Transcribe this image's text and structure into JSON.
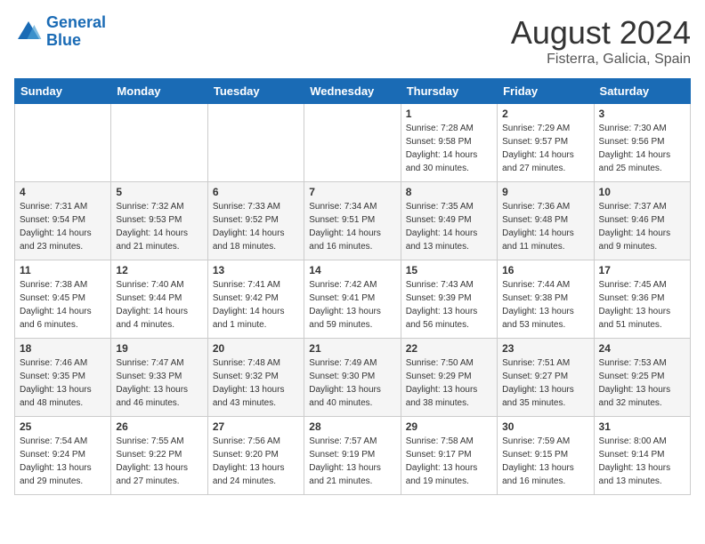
{
  "header": {
    "logo_line1": "General",
    "logo_line2": "Blue",
    "month": "August 2024",
    "location": "Fisterra, Galicia, Spain"
  },
  "days_of_week": [
    "Sunday",
    "Monday",
    "Tuesday",
    "Wednesday",
    "Thursday",
    "Friday",
    "Saturday"
  ],
  "weeks": [
    [
      {
        "day": "",
        "content": ""
      },
      {
        "day": "",
        "content": ""
      },
      {
        "day": "",
        "content": ""
      },
      {
        "day": "",
        "content": ""
      },
      {
        "day": "1",
        "content": "Sunrise: 7:28 AM\nSunset: 9:58 PM\nDaylight: 14 hours\nand 30 minutes."
      },
      {
        "day": "2",
        "content": "Sunrise: 7:29 AM\nSunset: 9:57 PM\nDaylight: 14 hours\nand 27 minutes."
      },
      {
        "day": "3",
        "content": "Sunrise: 7:30 AM\nSunset: 9:56 PM\nDaylight: 14 hours\nand 25 minutes."
      }
    ],
    [
      {
        "day": "4",
        "content": "Sunrise: 7:31 AM\nSunset: 9:54 PM\nDaylight: 14 hours\nand 23 minutes."
      },
      {
        "day": "5",
        "content": "Sunrise: 7:32 AM\nSunset: 9:53 PM\nDaylight: 14 hours\nand 21 minutes."
      },
      {
        "day": "6",
        "content": "Sunrise: 7:33 AM\nSunset: 9:52 PM\nDaylight: 14 hours\nand 18 minutes."
      },
      {
        "day": "7",
        "content": "Sunrise: 7:34 AM\nSunset: 9:51 PM\nDaylight: 14 hours\nand 16 minutes."
      },
      {
        "day": "8",
        "content": "Sunrise: 7:35 AM\nSunset: 9:49 PM\nDaylight: 14 hours\nand 13 minutes."
      },
      {
        "day": "9",
        "content": "Sunrise: 7:36 AM\nSunset: 9:48 PM\nDaylight: 14 hours\nand 11 minutes."
      },
      {
        "day": "10",
        "content": "Sunrise: 7:37 AM\nSunset: 9:46 PM\nDaylight: 14 hours\nand 9 minutes."
      }
    ],
    [
      {
        "day": "11",
        "content": "Sunrise: 7:38 AM\nSunset: 9:45 PM\nDaylight: 14 hours\nand 6 minutes."
      },
      {
        "day": "12",
        "content": "Sunrise: 7:40 AM\nSunset: 9:44 PM\nDaylight: 14 hours\nand 4 minutes."
      },
      {
        "day": "13",
        "content": "Sunrise: 7:41 AM\nSunset: 9:42 PM\nDaylight: 14 hours\nand 1 minute."
      },
      {
        "day": "14",
        "content": "Sunrise: 7:42 AM\nSunset: 9:41 PM\nDaylight: 13 hours\nand 59 minutes."
      },
      {
        "day": "15",
        "content": "Sunrise: 7:43 AM\nSunset: 9:39 PM\nDaylight: 13 hours\nand 56 minutes."
      },
      {
        "day": "16",
        "content": "Sunrise: 7:44 AM\nSunset: 9:38 PM\nDaylight: 13 hours\nand 53 minutes."
      },
      {
        "day": "17",
        "content": "Sunrise: 7:45 AM\nSunset: 9:36 PM\nDaylight: 13 hours\nand 51 minutes."
      }
    ],
    [
      {
        "day": "18",
        "content": "Sunrise: 7:46 AM\nSunset: 9:35 PM\nDaylight: 13 hours\nand 48 minutes."
      },
      {
        "day": "19",
        "content": "Sunrise: 7:47 AM\nSunset: 9:33 PM\nDaylight: 13 hours\nand 46 minutes."
      },
      {
        "day": "20",
        "content": "Sunrise: 7:48 AM\nSunset: 9:32 PM\nDaylight: 13 hours\nand 43 minutes."
      },
      {
        "day": "21",
        "content": "Sunrise: 7:49 AM\nSunset: 9:30 PM\nDaylight: 13 hours\nand 40 minutes."
      },
      {
        "day": "22",
        "content": "Sunrise: 7:50 AM\nSunset: 9:29 PM\nDaylight: 13 hours\nand 38 minutes."
      },
      {
        "day": "23",
        "content": "Sunrise: 7:51 AM\nSunset: 9:27 PM\nDaylight: 13 hours\nand 35 minutes."
      },
      {
        "day": "24",
        "content": "Sunrise: 7:53 AM\nSunset: 9:25 PM\nDaylight: 13 hours\nand 32 minutes."
      }
    ],
    [
      {
        "day": "25",
        "content": "Sunrise: 7:54 AM\nSunset: 9:24 PM\nDaylight: 13 hours\nand 29 minutes."
      },
      {
        "day": "26",
        "content": "Sunrise: 7:55 AM\nSunset: 9:22 PM\nDaylight: 13 hours\nand 27 minutes."
      },
      {
        "day": "27",
        "content": "Sunrise: 7:56 AM\nSunset: 9:20 PM\nDaylight: 13 hours\nand 24 minutes."
      },
      {
        "day": "28",
        "content": "Sunrise: 7:57 AM\nSunset: 9:19 PM\nDaylight: 13 hours\nand 21 minutes."
      },
      {
        "day": "29",
        "content": "Sunrise: 7:58 AM\nSunset: 9:17 PM\nDaylight: 13 hours\nand 19 minutes."
      },
      {
        "day": "30",
        "content": "Sunrise: 7:59 AM\nSunset: 9:15 PM\nDaylight: 13 hours\nand 16 minutes."
      },
      {
        "day": "31",
        "content": "Sunrise: 8:00 AM\nSunset: 9:14 PM\nDaylight: 13 hours\nand 13 minutes."
      }
    ]
  ]
}
